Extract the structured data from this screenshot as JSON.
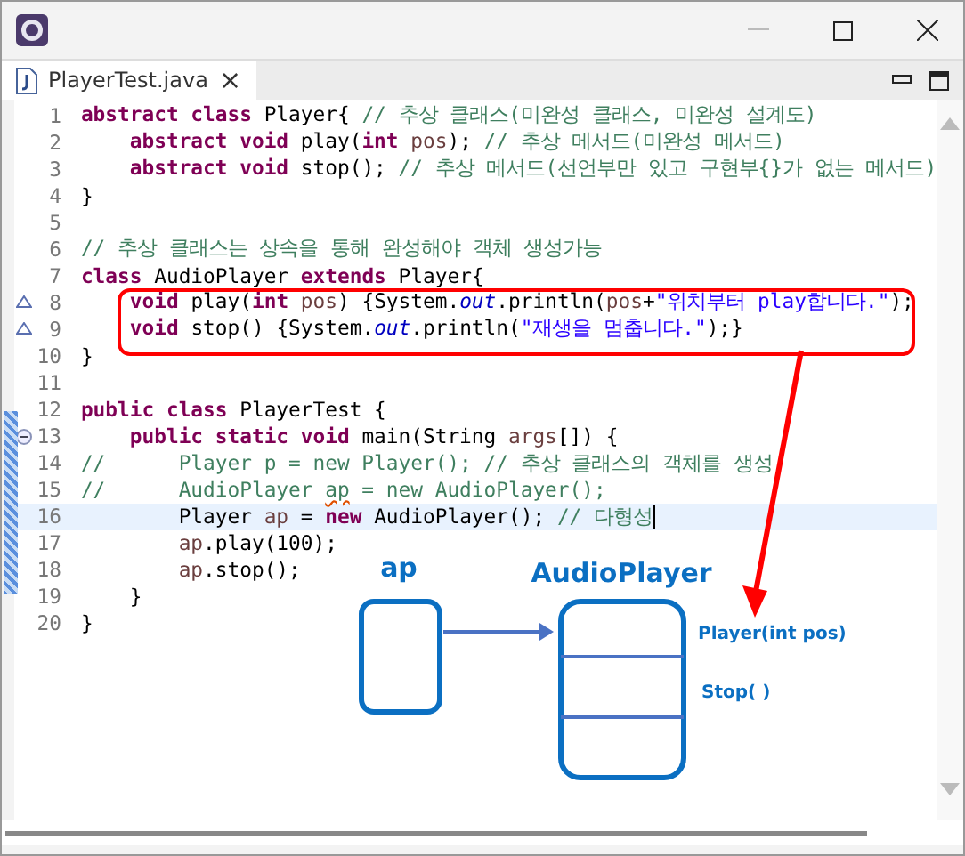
{
  "editor_tab": {
    "title": "PlayerTest.java",
    "close": "×",
    "selected": true
  },
  "lines": [
    {
      "number": "1",
      "override": false,
      "fold": false,
      "current": false,
      "segments": [
        {
          "kind": "kw",
          "text": "abstract class "
        },
        {
          "kind": "plain",
          "text": "Player{ "
        },
        {
          "kind": "comment",
          "text": "// 추상 클래스(미완성 클래스, 미완성 설계도)"
        }
      ]
    },
    {
      "number": "2",
      "override": false,
      "fold": false,
      "current": false,
      "segments": [
        {
          "kind": "kw",
          "text": "    abstract void "
        },
        {
          "kind": "plain",
          "text": "play("
        },
        {
          "kind": "kw",
          "text": "int "
        },
        {
          "kind": "local",
          "text": "pos"
        },
        {
          "kind": "plain",
          "text": "); "
        },
        {
          "kind": "comment",
          "text": "// 추상 메서드(미완성 메서드)"
        }
      ]
    },
    {
      "number": "3",
      "override": false,
      "fold": false,
      "current": false,
      "segments": [
        {
          "kind": "kw",
          "text": "    abstract void "
        },
        {
          "kind": "plain",
          "text": "stop(); "
        },
        {
          "kind": "comment",
          "text": "// 추상 메서드(선언부만 있고 구현부{}가 없는 메서드)"
        }
      ]
    },
    {
      "number": "4",
      "override": false,
      "fold": false,
      "current": false,
      "segments": [
        {
          "kind": "plain",
          "text": "}"
        }
      ]
    },
    {
      "number": "5",
      "override": false,
      "fold": false,
      "current": false
    },
    {
      "number": "6",
      "override": false,
      "fold": false,
      "current": false,
      "segments": [
        {
          "kind": "comment",
          "text": "// 추상 클래스는 상속을 통해 완성해야 객체 생성가능"
        }
      ]
    },
    {
      "number": "7",
      "override": false,
      "fold": false,
      "current": false,
      "segments": [
        {
          "kind": "kw",
          "text": "class "
        },
        {
          "kind": "plain",
          "text": "AudioPlayer "
        },
        {
          "kind": "kw",
          "text": "extends "
        },
        {
          "kind": "plain",
          "text": "Player{"
        }
      ]
    },
    {
      "number": "8",
      "override": true,
      "fold": false,
      "current": false,
      "segments": [
        {
          "kind": "kw",
          "text": "    void "
        },
        {
          "kind": "plain",
          "text": "play("
        },
        {
          "kind": "kw",
          "text": "int "
        },
        {
          "kind": "local",
          "text": "pos"
        },
        {
          "kind": "plain",
          "text": ") {System."
        },
        {
          "kind": "field",
          "text": "out"
        },
        {
          "kind": "plain",
          "text": ".println("
        },
        {
          "kind": "local",
          "text": "pos"
        },
        {
          "kind": "plain",
          "text": "+"
        },
        {
          "kind": "string",
          "text": "\"위치부터 play합니다.\""
        },
        {
          "kind": "plain",
          "text": ");"
        }
      ]
    },
    {
      "number": "9",
      "override": true,
      "fold": false,
      "current": false,
      "segments": [
        {
          "kind": "kw",
          "text": "    void "
        },
        {
          "kind": "plain",
          "text": "stop() {System."
        },
        {
          "kind": "field",
          "text": "out"
        },
        {
          "kind": "plain",
          "text": ".println("
        },
        {
          "kind": "string",
          "text": "\"재생을 멈춥니다.\""
        },
        {
          "kind": "plain",
          "text": ");}"
        }
      ]
    },
    {
      "number": "10",
      "override": false,
      "fold": false,
      "current": false,
      "segments": [
        {
          "kind": "plain",
          "text": "}"
        }
      ]
    },
    {
      "number": "11",
      "override": false,
      "fold": false,
      "current": false
    },
    {
      "number": "12",
      "override": false,
      "fold": false,
      "current": false,
      "segments": [
        {
          "kind": "kw",
          "text": "public class "
        },
        {
          "kind": "plain",
          "text": "PlayerTest {"
        }
      ]
    },
    {
      "number": "13",
      "override": false,
      "fold": true,
      "current": false,
      "segments": [
        {
          "kind": "kw",
          "text": "    public static void "
        },
        {
          "kind": "plain",
          "text": "main(String "
        },
        {
          "kind": "local",
          "text": "args"
        },
        {
          "kind": "plain",
          "text": "[]) {"
        }
      ]
    },
    {
      "number": "14",
      "override": false,
      "fold": false,
      "current": false,
      "segments": [
        {
          "kind": "comment",
          "text": "//      Player p = new Player(); // 추상 클래스의 객체를 생성"
        }
      ]
    },
    {
      "number": "15",
      "override": false,
      "fold": false,
      "current": false,
      "segments": [
        {
          "kind": "comment",
          "text": "//      AudioPlayer "
        },
        {
          "kind": "warning",
          "text": "ap"
        },
        {
          "kind": "comment",
          "text": " = new AudioPlayer();"
        }
      ]
    },
    {
      "number": "16",
      "override": false,
      "fold": false,
      "current": true,
      "segments": [
        {
          "kind": "plain",
          "text": "        Player "
        },
        {
          "kind": "local",
          "text": "ap"
        },
        {
          "kind": "plain",
          "text": " = "
        },
        {
          "kind": "kw",
          "text": "new "
        },
        {
          "kind": "plain",
          "text": "AudioPlayer(); "
        },
        {
          "kind": "comment",
          "text": "// 다형성"
        }
      ]
    },
    {
      "number": "17",
      "override": false,
      "fold": false,
      "current": false,
      "segments": [
        {
          "kind": "local",
          "text": "        ap"
        },
        {
          "kind": "plain",
          "text": ".play(100);"
        }
      ]
    },
    {
      "number": "18",
      "override": false,
      "fold": false,
      "current": false,
      "segments": [
        {
          "kind": "local",
          "text": "        ap"
        },
        {
          "kind": "plain",
          "text": ".stop();"
        }
      ]
    },
    {
      "number": "19",
      "override": false,
      "fold": false,
      "current": false,
      "segments": [
        {
          "kind": "plain",
          "text": "    }"
        }
      ]
    },
    {
      "number": "20",
      "override": false,
      "fold": false,
      "current": false,
      "segments": [
        {
          "kind": "plain",
          "text": "}"
        }
      ]
    }
  ],
  "diagram": {
    "variable": "ap",
    "object": "AudioPlayer",
    "methods": [
      "Player(int pos)",
      "Stop( )"
    ]
  }
}
